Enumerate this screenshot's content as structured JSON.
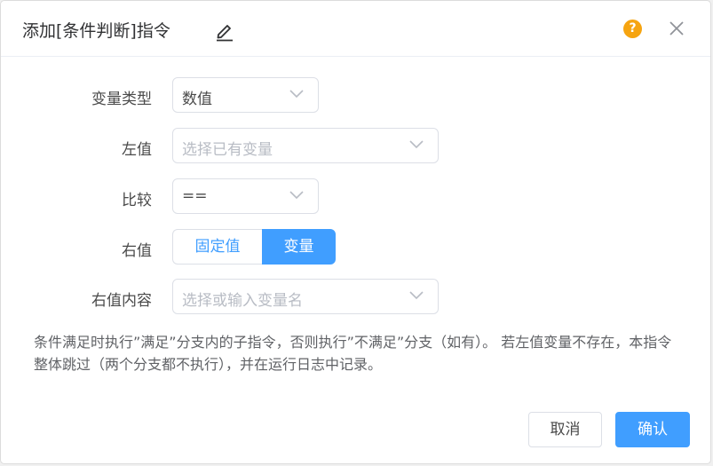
{
  "dialog": {
    "title": "添加[条件判断]指令",
    "help_glyph": "?"
  },
  "form": {
    "var_type": {
      "label": "变量类型",
      "value": "数值"
    },
    "left_value": {
      "label": "左值",
      "placeholder": "选择已有变量"
    },
    "compare": {
      "label": "比较",
      "value": "=="
    },
    "right_value": {
      "label": "右值",
      "options": [
        "固定值",
        "变量"
      ],
      "selected": "变量"
    },
    "right_content": {
      "label": "右值内容",
      "placeholder": "选择或输入变量名"
    }
  },
  "note": "条件满足时执行”满足”分支内的子指令，否则执行”不满足”分支（如有）。 若左值变量不存在，本指令整体跳过（两个分支都不执行），并在运行日志中记录。",
  "footer": {
    "cancel_label": "取消",
    "ok_label": "确认"
  },
  "colors": {
    "primary": "#409eff",
    "help": "#f6a410"
  }
}
